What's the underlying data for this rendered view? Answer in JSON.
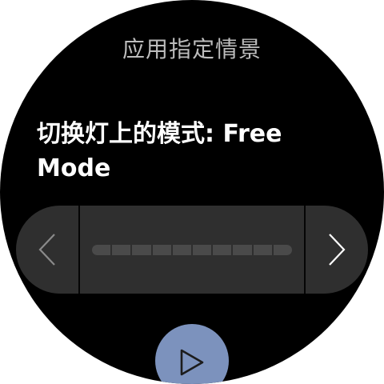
{
  "header": {
    "title": "应用指定情景"
  },
  "prompt": {
    "text": "切换灯上的模式: Free Mode"
  },
  "selector": {
    "segment_count": 10,
    "previous_icon": "chevron-left-icon",
    "next_icon": "chevron-right-icon"
  },
  "action": {
    "icon": "play-icon",
    "color": "#7c92bd"
  }
}
